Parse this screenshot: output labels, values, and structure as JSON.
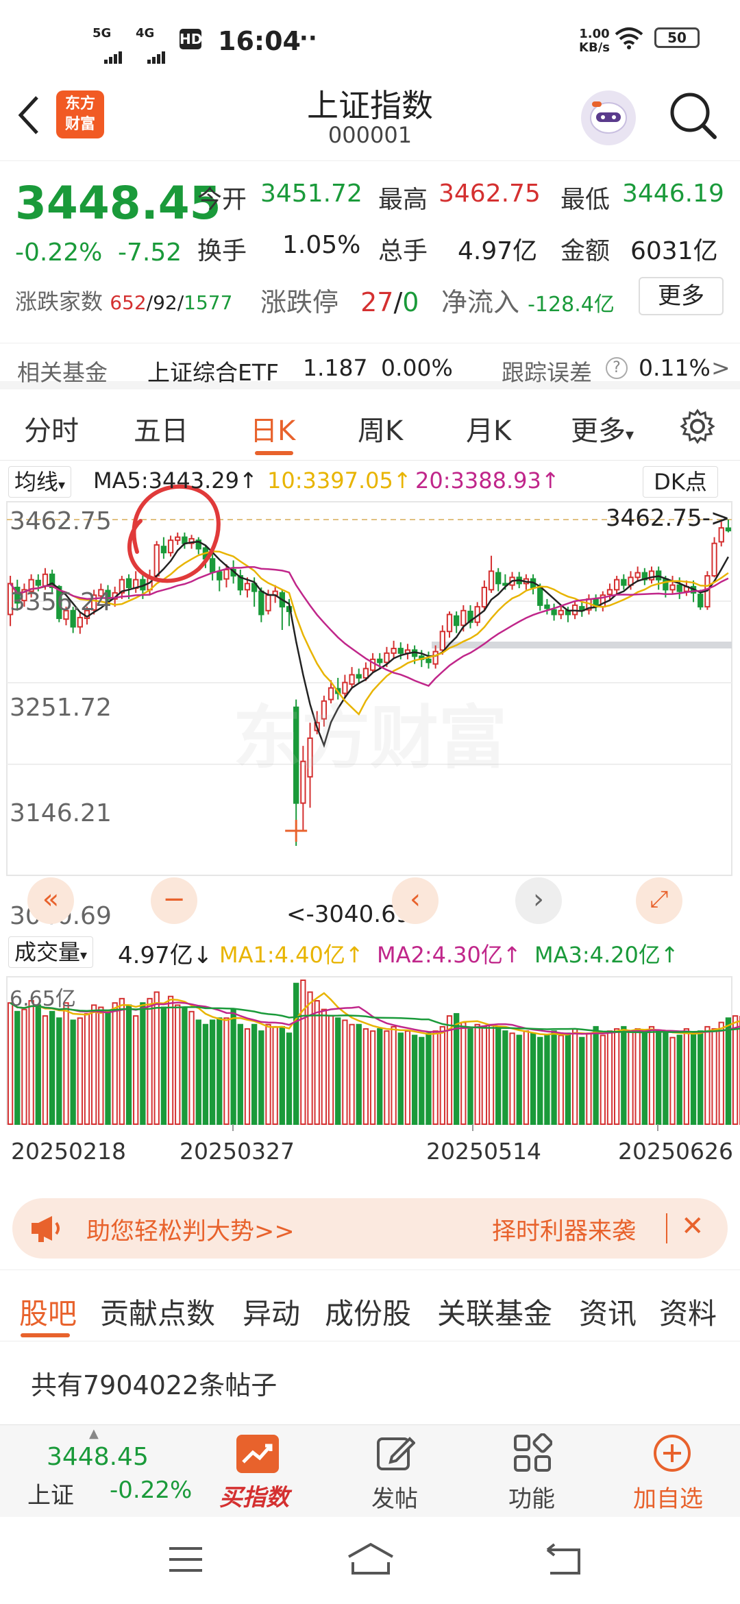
{
  "status_bar": {
    "signal1": "5G",
    "signal2": "4G",
    "hd": "HD",
    "time": "16:04",
    "dots": "···",
    "speed_value": "1.00",
    "speed_unit": "KB/s",
    "battery": "50"
  },
  "header": {
    "logo_line1": "东方",
    "logo_line2": "财富",
    "title": "上证指数",
    "code": "000001"
  },
  "quote": {
    "price": "3448.45",
    "change_pct": "-0.22%",
    "change": "-7.52",
    "open_label": "今开",
    "open": "3451.72",
    "high_label": "最高",
    "high": "3462.75",
    "low_label": "最低",
    "low": "3446.19",
    "turnover_label": "换手",
    "turnover": "1.05%",
    "volume_label": "总手",
    "volume": "4.97亿",
    "amount_label": "金额",
    "amount": "6031亿",
    "breadth_label": "涨跌家数",
    "breadth_up": "652",
    "breadth_sep1": "/",
    "breadth_flat": "92",
    "breadth_sep2": "/",
    "breadth_down": "1577",
    "limit_label": "涨跌停",
    "limit_up": "27",
    "limit_sep": "/",
    "limit_down": "0",
    "netflow_label": "净流入",
    "netflow": "-128.4亿",
    "more_button": "更多"
  },
  "fund": {
    "label": "相关基金",
    "name": "上证综合ETF",
    "price": "1.187",
    "pct": "0.00%",
    "track_label": "跟踪误差",
    "help": "?",
    "track_value": "0.11%",
    "arrow": ">"
  },
  "period_tabs": [
    "分时",
    "五日",
    "日K",
    "周K",
    "月K",
    "更多"
  ],
  "period_active": 2,
  "indicator": {
    "select_label": "均线",
    "ma5": "MA5:3443.29",
    "ma10": "10:3397.05",
    "ma20": "20:3388.93",
    "dk_label": "DK点",
    "up_arrow": "↑",
    "dropdown": "▾"
  },
  "chart_labels": {
    "y_ticks": [
      "3462.75",
      "3356.24",
      "3251.72",
      "3146.21",
      "3040.69"
    ],
    "high_marker": "3462.75->",
    "low_marker": "<-3040.69",
    "watermark": "东方财富"
  },
  "volume_panel": {
    "select_label": "成交量",
    "value": "4.97亿",
    "down_arrow": "↓",
    "ma1": "MA1:4.40亿",
    "ma2": "MA2:4.30亿",
    "ma3": "MA3:4.20亿",
    "max_label": "6.65亿"
  },
  "x_dates": [
    "20250218",
    "20250327",
    "20250514",
    "20250626"
  ],
  "chart_buttons": {
    "back": "«",
    "zoom_out": "−",
    "prev": "‹",
    "next": "›",
    "expand": "⤢"
  },
  "banner": {
    "left_text": "助您轻松判大势>>",
    "right_text": "择时利器来袭",
    "close": "✕"
  },
  "bottom_tabs": [
    "股吧",
    "贡献点数",
    "异动",
    "成份股",
    "关联基金",
    "资讯",
    "资料"
  ],
  "bottom_active": 0,
  "posts_text": "共有7904022条帖子",
  "bottom_bar": {
    "mini_price": "3448.45",
    "mini_name": "上证",
    "mini_pct": "-0.22%",
    "buy_label": "买指数",
    "post_label": "发帖",
    "func_label": "功能",
    "add_label": "加自选"
  },
  "colors": {
    "up": "#d43030",
    "down": "#1a9a3a",
    "accent": "#e8622c",
    "ma5": "#222222",
    "ma10": "#e8b400",
    "ma20": "#c0268a"
  },
  "chart_data": {
    "type": "candlestick",
    "ylim": [
      3040.69,
      3462.75
    ],
    "candles": [
      {
        "o": 3340,
        "c": 3380,
        "h": 3390,
        "l": 3325
      },
      {
        "o": 3375,
        "c": 3355,
        "h": 3385,
        "l": 3345
      },
      {
        "o": 3358,
        "c": 3372,
        "h": 3380,
        "l": 3350
      },
      {
        "o": 3370,
        "c": 3385,
        "h": 3392,
        "l": 3362
      },
      {
        "o": 3384,
        "c": 3378,
        "h": 3392,
        "l": 3370
      },
      {
        "o": 3377,
        "c": 3392,
        "h": 3400,
        "l": 3372
      },
      {
        "o": 3392,
        "c": 3375,
        "h": 3398,
        "l": 3368
      },
      {
        "o": 3376,
        "c": 3335,
        "h": 3378,
        "l": 3330
      },
      {
        "o": 3334,
        "c": 3345,
        "h": 3350,
        "l": 3326
      },
      {
        "o": 3345,
        "c": 3324,
        "h": 3350,
        "l": 3316
      },
      {
        "o": 3324,
        "c": 3336,
        "h": 3344,
        "l": 3315
      },
      {
        "o": 3335,
        "c": 3345,
        "h": 3350,
        "l": 3327
      },
      {
        "o": 3346,
        "c": 3365,
        "h": 3372,
        "l": 3340
      },
      {
        "o": 3364,
        "c": 3372,
        "h": 3380,
        "l": 3356
      },
      {
        "o": 3371,
        "c": 3360,
        "h": 3378,
        "l": 3352
      },
      {
        "o": 3360,
        "c": 3368,
        "h": 3376,
        "l": 3350
      },
      {
        "o": 3368,
        "c": 3385,
        "h": 3390,
        "l": 3360
      },
      {
        "o": 3386,
        "c": 3375,
        "h": 3392,
        "l": 3360
      },
      {
        "o": 3374,
        "c": 3385,
        "h": 3396,
        "l": 3368
      },
      {
        "o": 3385,
        "c": 3372,
        "h": 3392,
        "l": 3360
      },
      {
        "o": 3372,
        "c": 3388,
        "h": 3398,
        "l": 3365
      },
      {
        "o": 3390,
        "c": 3430,
        "h": 3435,
        "l": 3385
      },
      {
        "o": 3428,
        "c": 3420,
        "h": 3440,
        "l": 3412
      },
      {
        "o": 3420,
        "c": 3436,
        "h": 3442,
        "l": 3415
      },
      {
        "o": 3436,
        "c": 3440,
        "h": 3446,
        "l": 3430
      },
      {
        "o": 3440,
        "c": 3432,
        "h": 3446,
        "l": 3425
      },
      {
        "o": 3432,
        "c": 3438,
        "h": 3443,
        "l": 3425
      },
      {
        "o": 3436,
        "c": 3425,
        "h": 3440,
        "l": 3418
      },
      {
        "o": 3426,
        "c": 3412,
        "h": 3430,
        "l": 3400
      },
      {
        "o": 3412,
        "c": 3395,
        "h": 3420,
        "l": 3384
      },
      {
        "o": 3395,
        "c": 3385,
        "h": 3402,
        "l": 3370
      },
      {
        "o": 3386,
        "c": 3398,
        "h": 3405,
        "l": 3375
      },
      {
        "o": 3398,
        "c": 3390,
        "h": 3410,
        "l": 3380
      },
      {
        "o": 3390,
        "c": 3372,
        "h": 3398,
        "l": 3365
      },
      {
        "o": 3372,
        "c": 3380,
        "h": 3388,
        "l": 3362
      },
      {
        "o": 3380,
        "c": 3370,
        "h": 3388,
        "l": 3350
      },
      {
        "o": 3370,
        "c": 3340,
        "h": 3375,
        "l": 3330
      },
      {
        "o": 3345,
        "c": 3365,
        "h": 3372,
        "l": 3340
      },
      {
        "o": 3365,
        "c": 3370,
        "h": 3378,
        "l": 3355
      },
      {
        "o": 3368,
        "c": 3350,
        "h": 3372,
        "l": 3320
      },
      {
        "o": 3350,
        "c": 3344,
        "h": 3360,
        "l": 3325
      },
      {
        "o": 3220,
        "c": 3096,
        "h": 3230,
        "l": 3040.69
      },
      {
        "o": 3096,
        "c": 3150,
        "h": 3170,
        "l": 3060
      },
      {
        "o": 3130,
        "c": 3180,
        "h": 3200,
        "l": 3090
      },
      {
        "o": 3190,
        "c": 3200,
        "h": 3215,
        "l": 3185
      },
      {
        "o": 3205,
        "c": 3228,
        "h": 3235,
        "l": 3195
      },
      {
        "o": 3230,
        "c": 3245,
        "h": 3255,
        "l": 3225
      },
      {
        "o": 3244,
        "c": 3238,
        "h": 3258,
        "l": 3230
      },
      {
        "o": 3238,
        "c": 3252,
        "h": 3262,
        "l": 3232
      },
      {
        "o": 3250,
        "c": 3262,
        "h": 3272,
        "l": 3246
      },
      {
        "o": 3262,
        "c": 3258,
        "h": 3270,
        "l": 3250
      },
      {
        "o": 3258,
        "c": 3270,
        "h": 3278,
        "l": 3254
      },
      {
        "o": 3268,
        "c": 3282,
        "h": 3290,
        "l": 3264
      },
      {
        "o": 3282,
        "c": 3278,
        "h": 3290,
        "l": 3270
      },
      {
        "o": 3278,
        "c": 3290,
        "h": 3298,
        "l": 3272
      },
      {
        "o": 3290,
        "c": 3296,
        "h": 3306,
        "l": 3284
      },
      {
        "o": 3296,
        "c": 3290,
        "h": 3304,
        "l": 3282
      },
      {
        "o": 3290,
        "c": 3294,
        "h": 3302,
        "l": 3282
      },
      {
        "o": 3294,
        "c": 3286,
        "h": 3300,
        "l": 3276
      },
      {
        "o": 3286,
        "c": 3282,
        "h": 3294,
        "l": 3272
      },
      {
        "o": 3282,
        "c": 3278,
        "h": 3292,
        "l": 3270
      },
      {
        "o": 3276,
        "c": 3292,
        "h": 3300,
        "l": 3270
      },
      {
        "o": 3294,
        "c": 3318,
        "h": 3326,
        "l": 3288
      },
      {
        "o": 3318,
        "c": 3340,
        "h": 3344,
        "l": 3310
      },
      {
        "o": 3338,
        "c": 3326,
        "h": 3344,
        "l": 3316
      },
      {
        "o": 3326,
        "c": 3345,
        "h": 3352,
        "l": 3318
      },
      {
        "o": 3344,
        "c": 3330,
        "h": 3352,
        "l": 3322
      },
      {
        "o": 3330,
        "c": 3350,
        "h": 3356,
        "l": 3325
      },
      {
        "o": 3350,
        "c": 3375,
        "h": 3384,
        "l": 3345
      },
      {
        "o": 3372,
        "c": 3396,
        "h": 3416,
        "l": 3368
      },
      {
        "o": 3394,
        "c": 3380,
        "h": 3400,
        "l": 3370
      },
      {
        "o": 3380,
        "c": 3378,
        "h": 3392,
        "l": 3372
      },
      {
        "o": 3378,
        "c": 3388,
        "h": 3395,
        "l": 3372
      },
      {
        "o": 3388,
        "c": 3380,
        "h": 3395,
        "l": 3374
      },
      {
        "o": 3380,
        "c": 3386,
        "h": 3392,
        "l": 3372
      },
      {
        "o": 3386,
        "c": 3375,
        "h": 3392,
        "l": 3366
      },
      {
        "o": 3376,
        "c": 3352,
        "h": 3380,
        "l": 3345
      },
      {
        "o": 3352,
        "c": 3348,
        "h": 3360,
        "l": 3340
      },
      {
        "o": 3346,
        "c": 3340,
        "h": 3354,
        "l": 3332
      },
      {
        "o": 3340,
        "c": 3345,
        "h": 3352,
        "l": 3334
      },
      {
        "o": 3345,
        "c": 3340,
        "h": 3350,
        "l": 3330
      },
      {
        "o": 3340,
        "c": 3352,
        "h": 3358,
        "l": 3334
      },
      {
        "o": 3350,
        "c": 3345,
        "h": 3356,
        "l": 3337
      },
      {
        "o": 3346,
        "c": 3360,
        "h": 3366,
        "l": 3340
      },
      {
        "o": 3360,
        "c": 3350,
        "h": 3366,
        "l": 3344
      },
      {
        "o": 3350,
        "c": 3365,
        "h": 3370,
        "l": 3344
      },
      {
        "o": 3366,
        "c": 3372,
        "h": 3380,
        "l": 3358
      },
      {
        "o": 3372,
        "c": 3385,
        "h": 3390,
        "l": 3366
      },
      {
        "o": 3385,
        "c": 3378,
        "h": 3392,
        "l": 3372
      },
      {
        "o": 3378,
        "c": 3388,
        "h": 3396,
        "l": 3372
      },
      {
        "o": 3388,
        "c": 3394,
        "h": 3402,
        "l": 3382
      },
      {
        "o": 3394,
        "c": 3385,
        "h": 3400,
        "l": 3378
      },
      {
        "o": 3385,
        "c": 3396,
        "h": 3402,
        "l": 3380
      },
      {
        "o": 3396,
        "c": 3385,
        "h": 3402,
        "l": 3372
      },
      {
        "o": 3386,
        "c": 3372,
        "h": 3390,
        "l": 3362
      },
      {
        "o": 3372,
        "c": 3378,
        "h": 3390,
        "l": 3366
      },
      {
        "o": 3378,
        "c": 3370,
        "h": 3388,
        "l": 3360
      },
      {
        "o": 3370,
        "c": 3376,
        "h": 3384,
        "l": 3364
      },
      {
        "o": 3376,
        "c": 3368,
        "h": 3384,
        "l": 3356
      },
      {
        "o": 3366,
        "c": 3350,
        "h": 3372,
        "l": 3346
      },
      {
        "o": 3350,
        "c": 3390,
        "h": 3396,
        "l": 3346
      },
      {
        "o": 3390,
        "c": 3432,
        "h": 3440,
        "l": 3388
      },
      {
        "o": 3434,
        "c": 3452,
        "h": 3460,
        "l": 3428
      },
      {
        "o": 3451.72,
        "c": 3448.45,
        "h": 3462.75,
        "l": 3446.19
      }
    ],
    "volumes": [
      5.6,
      5.2,
      5.3,
      5.7,
      5.5,
      5.0,
      5.2,
      4.9,
      5.6,
      4.8,
      4.9,
      5.1,
      5.5,
      5.4,
      5.2,
      5.6,
      5.8,
      5.5,
      5.0,
      5.6,
      5.8,
      6.1,
      5.4,
      5.9,
      5.5,
      5.4,
      5.2,
      4.8,
      4.6,
      4.8,
      4.9,
      4.9,
      5.3,
      4.6,
      4.4,
      4.6,
      4.3,
      4.6,
      4.5,
      4.5,
      4.2,
      6.5,
      6.65,
      6.1,
      5.7,
      5.3,
      5.0,
      4.9,
      4.8,
      4.6,
      4.6,
      4.4,
      4.3,
      4.4,
      4.3,
      4.5,
      4.2,
      4.3,
      4.1,
      4.0,
      4.2,
      4.3,
      4.5,
      5.0,
      5.1,
      4.7,
      4.4,
      4.6,
      4.5,
      4.6,
      4.5,
      4.3,
      4.2,
      4.1,
      4.3,
      4.2,
      4.0,
      4.1,
      4.3,
      4.1,
      4.2,
      4.4,
      4.0,
      4.2,
      4.5,
      4.1,
      4.3,
      4.4,
      4.5,
      4.3,
      4.4,
      4.2,
      4.5,
      4.3,
      4.2,
      4.0,
      4.1,
      4.4,
      4.2,
      4.3,
      4.5,
      4.4,
      4.7,
      4.9,
      5.0,
      4.97
    ],
    "ma_periods": [
      5,
      10,
      20
    ],
    "volume_ma_values": [
      "4.40亿",
      "4.30亿",
      "4.20亿"
    ]
  }
}
